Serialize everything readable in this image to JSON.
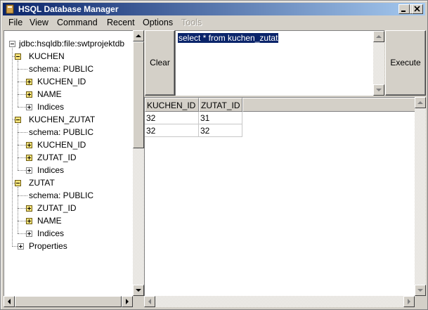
{
  "window": {
    "title": "HSQL Database Manager"
  },
  "menu": {
    "items": [
      "File",
      "View",
      "Command",
      "Recent",
      "Options"
    ],
    "disabled_item": "Tools"
  },
  "tree": {
    "root": "jdbc:hsqldb:file:swtprojektdb",
    "tables": [
      {
        "name": "KUCHEN",
        "schema": "schema: PUBLIC",
        "columns": [
          "KUCHEN_ID",
          "NAME"
        ],
        "indices": "Indices"
      },
      {
        "name": "KUCHEN_ZUTAT",
        "schema": "schema: PUBLIC",
        "columns": [
          "KUCHEN_ID",
          "ZUTAT_ID"
        ],
        "indices": "Indices"
      },
      {
        "name": "ZUTAT",
        "schema": "schema: PUBLIC",
        "columns": [
          "ZUTAT_ID",
          "NAME"
        ],
        "indices": "Indices"
      }
    ],
    "properties": "Properties"
  },
  "buttons": {
    "clear": "Clear",
    "execute": "Execute"
  },
  "query": {
    "text": "select * from kuchen_zutat"
  },
  "results": {
    "columns": [
      "KUCHEN_ID",
      "ZUTAT_ID"
    ],
    "rows": [
      [
        "32",
        "31"
      ],
      [
        "32",
        "32"
      ]
    ]
  },
  "colors": {
    "titlebar_start": "#0a246a",
    "titlebar_end": "#a6caf0",
    "face": "#d4d0c8",
    "selection": "#0a246a"
  }
}
